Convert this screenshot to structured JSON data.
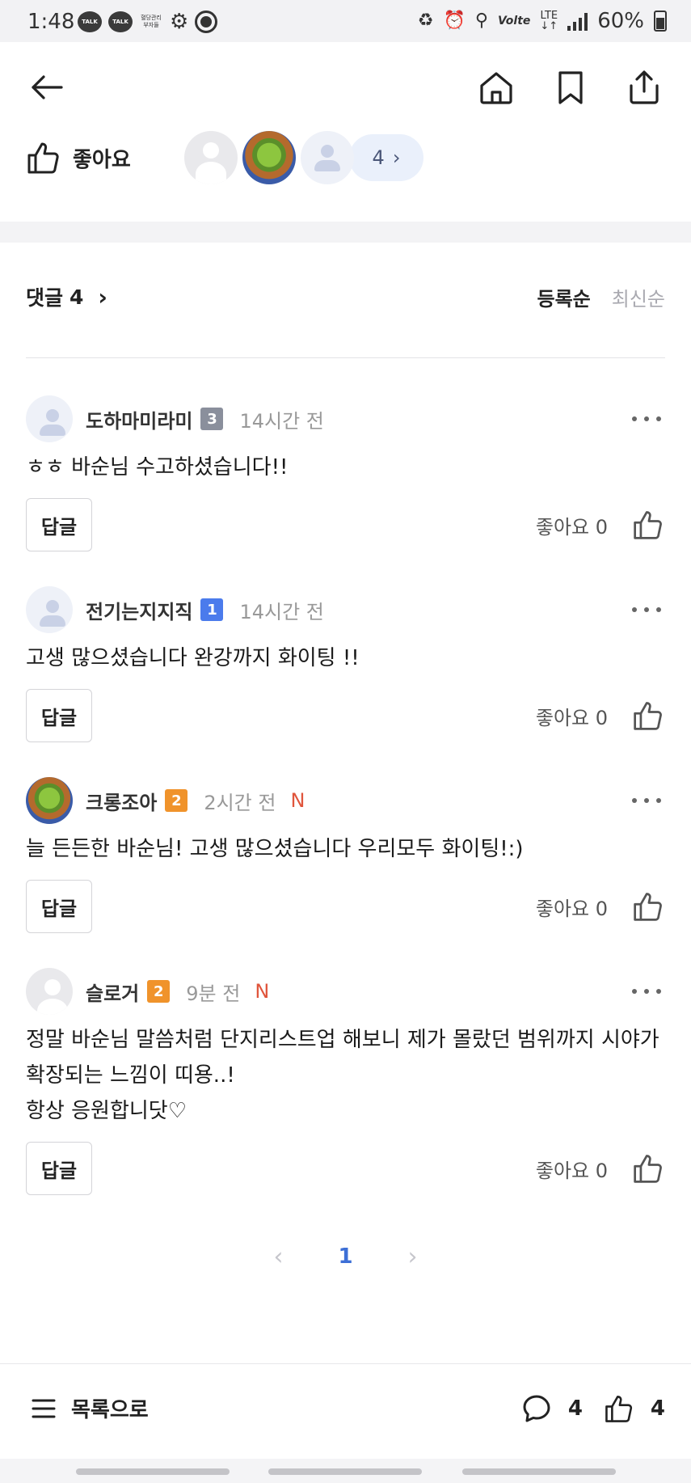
{
  "status_bar": {
    "time": "1:48",
    "left_icons": [
      "kakaotalk-icon",
      "kakaotalk-icon",
      "notification-app-icon",
      "gear-icon",
      "globe-icon"
    ],
    "talk_label": "TALK",
    "mini_app_label": "혈당관리 부자들",
    "network_label": "Volte",
    "lte_label": "LTE",
    "battery": "60%"
  },
  "nav": {
    "back_icon": "back-arrow-icon",
    "home_icon": "home-icon",
    "bookmark_icon": "bookmark-icon",
    "share_icon": "share-icon"
  },
  "likes": {
    "label": "좋아요",
    "more_count": "4",
    "more_icon": "chevron-right-icon"
  },
  "comments_header": {
    "title": "댓글",
    "count": "4",
    "sort_options": [
      "등록순",
      "최신순"
    ],
    "active_sort": "등록순"
  },
  "comments": [
    {
      "author": "도하마미라미",
      "level": "3",
      "level_color": "#8a8f9c",
      "time": "14시간 전",
      "new_badge": "",
      "body": "ㅎㅎ 바순님 수고하셨습니다!!",
      "reply_label": "답글",
      "like_label": "좋아요 0",
      "avatar": "default-avatar"
    },
    {
      "author": "전기는지지직",
      "level": "1",
      "level_color": "#4b7bec",
      "time": "14시간 전",
      "new_badge": "",
      "body": "고생 많으셨습니다 완강까지 화이팅 !!",
      "reply_label": "답글",
      "like_label": "좋아요 0",
      "avatar": "default-avatar"
    },
    {
      "author": "크롱조아",
      "level": "2",
      "level_color": "#f0932b",
      "time": "2시간 전",
      "new_badge": "N",
      "body": "늘 든든한 바순님! 고생 많으셨습니다 우리모두 화이팅!:)",
      "reply_label": "답글",
      "like_label": "좋아요 0",
      "avatar": "frog-avatar"
    },
    {
      "author": "슬로거",
      "level": "2",
      "level_color": "#f0932b",
      "time": "9분 전",
      "new_badge": "N",
      "body": "정말 바순님 말씀처럼 단지리스트업 해보니 제가 몰랐던 범위까지 시야가 확장되는 느낌이 띠용..!\n항상 응원합니닷♡",
      "reply_label": "답글",
      "like_label": "좋아요 0",
      "avatar": "grey-avatar"
    }
  ],
  "pagination": {
    "current_page": "1",
    "prev_glyph": "‹",
    "next_glyph": "›"
  },
  "bottom_bar": {
    "list_label": "목록으로",
    "comment_count": "4",
    "like_count": "4"
  },
  "colors": {
    "accent_blue": "#3d6fd6",
    "new_red": "#e0553c"
  }
}
